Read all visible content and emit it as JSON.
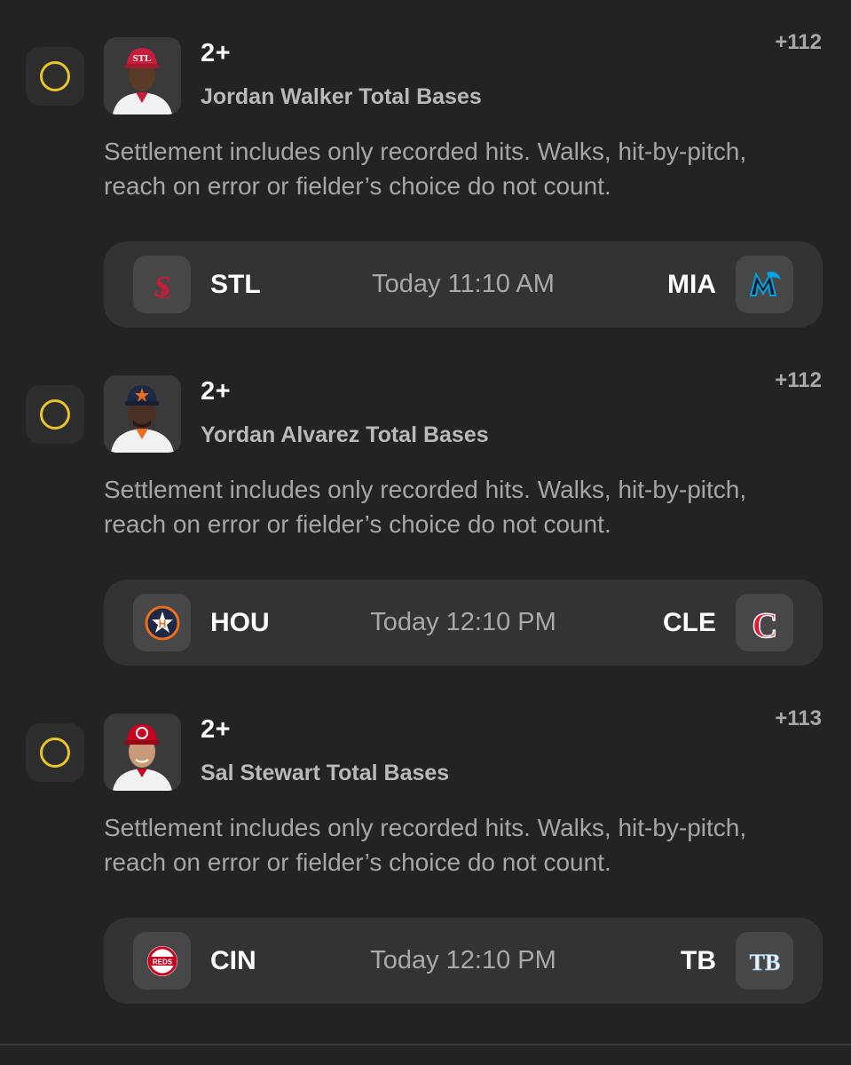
{
  "picks": [
    {
      "line": "2+",
      "market": "Jordan Walker Total Bases",
      "odds": "+112",
      "description": "Settlement includes only recorded hits. Walks, hit-by-pitch, reach on error or fielder’s choice do not count.",
      "avatar": {
        "cap_color": "#c41e3a",
        "skin_color": "#5a3a28",
        "jersey_color": "#f2f2f2",
        "cap_mark": "STL-cap-logo"
      },
      "game": {
        "home_abbr": "STL",
        "home_logo": "cardinals-logo",
        "home_color": "#c41e3a",
        "time": "Today 11:10 AM",
        "away_abbr": "MIA",
        "away_logo": "marlins-logo",
        "away_color": "#00a3e0"
      }
    },
    {
      "line": "2+",
      "market": "Yordan Alvarez Total Bases",
      "odds": "+112",
      "description": "Settlement includes only recorded hits. Walks, hit-by-pitch, reach on error or fielder’s choice do not count.",
      "avatar": {
        "cap_color": "#1e2a45",
        "skin_color": "#4a3024",
        "jersey_color": "#f2f2f2",
        "cap_mark": "HOU-cap-logo"
      },
      "game": {
        "home_abbr": "HOU",
        "home_logo": "astros-logo",
        "home_color": "#eb6e1f",
        "time": "Today 12:10 PM",
        "away_abbr": "CLE",
        "away_logo": "guardians-logo",
        "away_color": "#e31937"
      }
    },
    {
      "line": "2+",
      "market": "Sal Stewart Total Bases",
      "odds": "+113",
      "description": "Settlement includes only recorded hits. Walks, hit-by-pitch, reach on error or fielder’s choice do not count.",
      "avatar": {
        "cap_color": "#c6011f",
        "skin_color": "#c99a7a",
        "jersey_color": "#f2f2f2",
        "cap_mark": "CIN-cap-logo"
      },
      "game": {
        "home_abbr": "CIN",
        "home_logo": "reds-logo",
        "home_color": "#c6011f",
        "time": "Today 12:10 PM",
        "away_abbr": "TB",
        "away_logo": "rays-logo",
        "away_color": "#8fbce6"
      }
    }
  ],
  "reds_wordmark": "REDS",
  "rays_wordmark": "TB",
  "guardians_mark": "C"
}
